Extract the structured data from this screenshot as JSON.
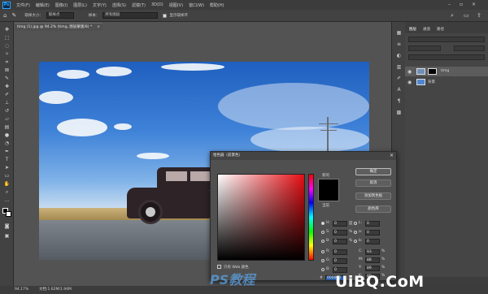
{
  "menubar": {
    "logo": "Ps",
    "items": [
      "文件(F)",
      "编辑(E)",
      "图像(I)",
      "图层(L)",
      "文字(Y)",
      "选择(S)",
      "滤镜(T)",
      "3D(D)",
      "视图(V)",
      "窗口(W)",
      "帮助(H)"
    ]
  },
  "options": {
    "size_label": "取样大小：",
    "size_value": "取样点",
    "sample_label": "样本：",
    "sample_value": "所有图层",
    "ring_label": "显示取样环"
  },
  "document": {
    "tab_title": "timg (1).jpg @ 94.2% (timg, 图层蒙版/8) *",
    "tab_close": "×"
  },
  "panels": {
    "tabs": [
      "图层",
      "通道",
      "路径"
    ],
    "layers": [
      {
        "name": "timg",
        "visible": true
      },
      {
        "name": "背景",
        "visible": true
      }
    ]
  },
  "status": {
    "zoom": "94.17%",
    "doc_info": "文档:1.62M/1.94M"
  },
  "picker": {
    "title": "拾色器（前景色）",
    "new_label": "新的",
    "current_label": "当前",
    "ok_label": "确定",
    "cancel_label": "取消",
    "add_swatch_label": "添加到色板",
    "color_lib_label": "颜色库",
    "web_only_label": "只有 Web 颜色",
    "hex_prefix": "#",
    "hex_value": "000000",
    "fields": {
      "H": {
        "label": "H:",
        "value": "0",
        "unit": "度"
      },
      "S": {
        "label": "S:",
        "value": "0",
        "unit": "%"
      },
      "B": {
        "label": "B:",
        "value": "0",
        "unit": "%"
      },
      "R": {
        "label": "R:",
        "value": "0"
      },
      "G": {
        "label": "G:",
        "value": "0"
      },
      "Bl": {
        "label": "B:",
        "value": "0"
      },
      "L": {
        "label": "L:",
        "value": "0"
      },
      "a": {
        "label": "a:",
        "value": "0"
      },
      "b": {
        "label": "b:",
        "value": "0"
      },
      "C": {
        "label": "C:",
        "value": "93",
        "unit": "%"
      },
      "M": {
        "label": "M:",
        "value": "88",
        "unit": "%"
      },
      "Y": {
        "label": "Y:",
        "value": "89",
        "unit": "%"
      },
      "K": {
        "label": "K:",
        "value": "80",
        "unit": "%"
      }
    }
  },
  "watermarks": {
    "site": "UiBQ.CoM",
    "ps": "PS教程"
  },
  "colors": {
    "accent": "#31a8ff",
    "foreground": "#000000"
  }
}
